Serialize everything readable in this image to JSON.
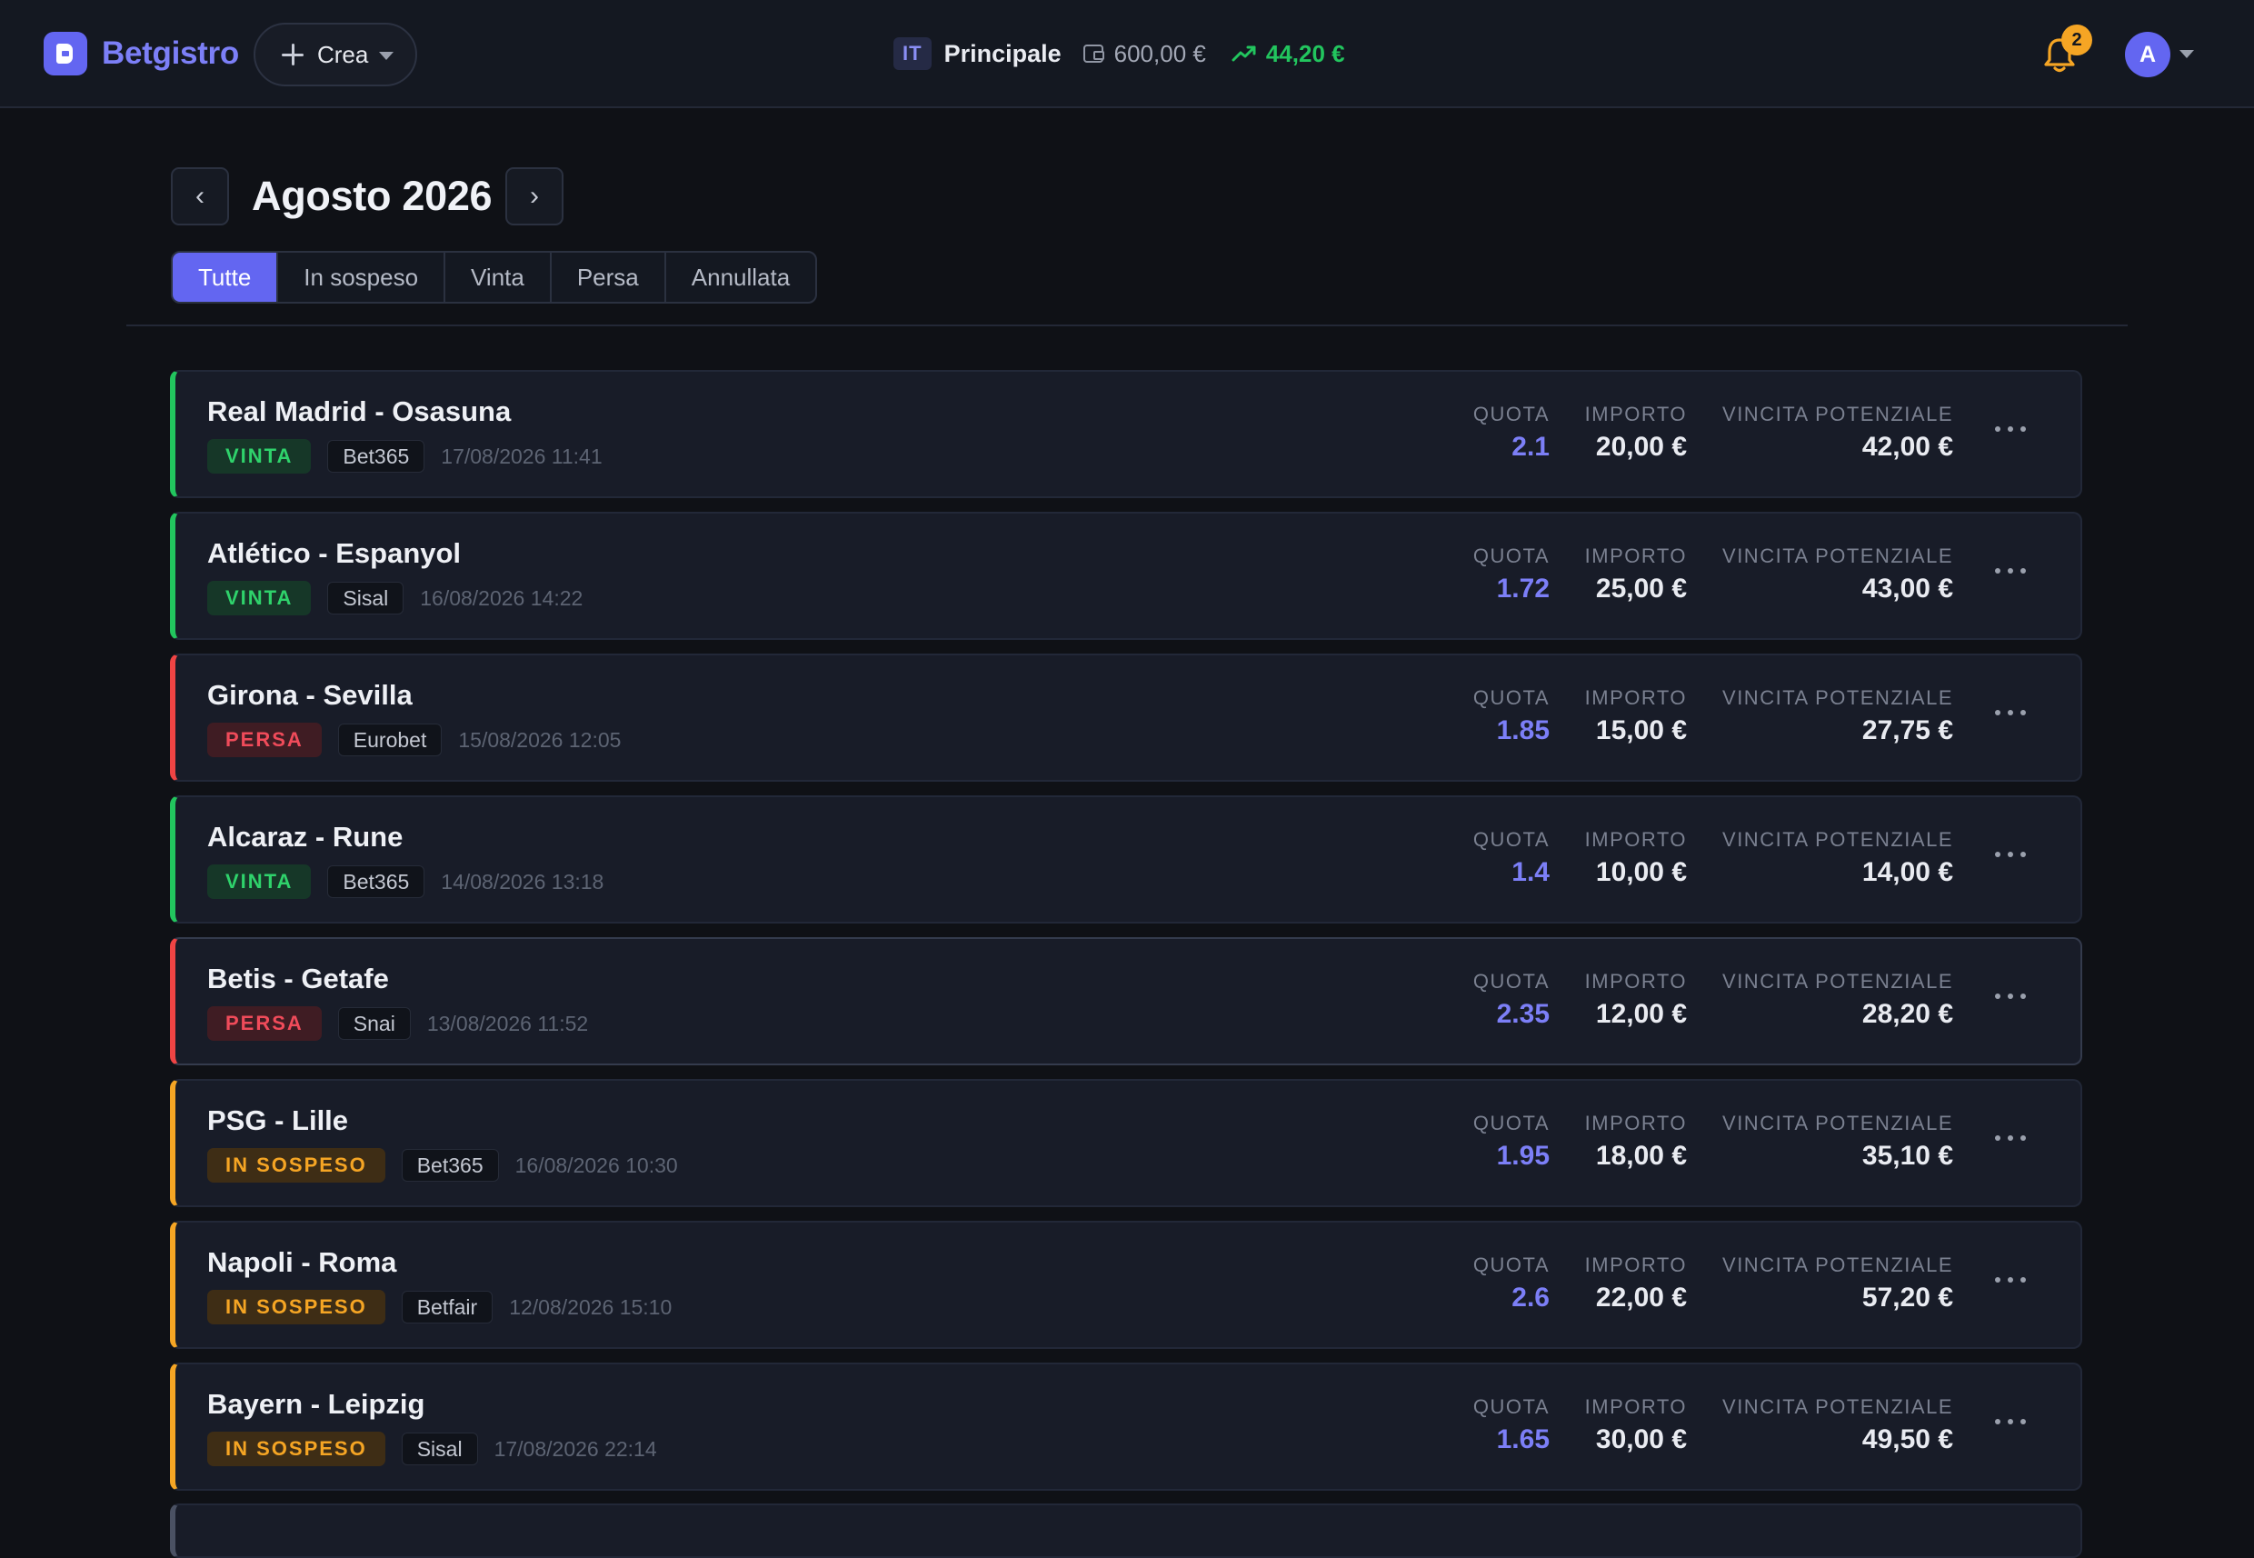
{
  "header": {
    "brand": "Betgistro",
    "create_label": "Crea",
    "account_code": "IT",
    "account_name": "Principale",
    "balance": "600,00 €",
    "profit": "44,20 €",
    "notifications_count": "2",
    "avatar_initial": "A",
    "colors": {
      "accent": "#6366f1",
      "profit": "#22c55e",
      "badge": "#f5a524"
    }
  },
  "month": {
    "prev_label": "‹",
    "title": "Agosto 2026",
    "next_label": "›"
  },
  "filters": [
    {
      "label": "Tutte",
      "active": true
    },
    {
      "label": "In sospeso",
      "active": false
    },
    {
      "label": "Vinta",
      "active": false
    },
    {
      "label": "Persa",
      "active": false
    },
    {
      "label": "Annullata",
      "active": false
    }
  ],
  "columns": {
    "quota": "QUOTA",
    "importo": "IMPORTO",
    "vincita": "VINCITA POTENZIALE"
  },
  "bets": [
    {
      "title": "Real Madrid - Osasuna",
      "status": "VINTA",
      "status_kind": "win",
      "book": "Bet365",
      "date": "17/08/2026 11:41",
      "quota": "2.1",
      "importo": "20,00 €",
      "vincita": "42,00 €"
    },
    {
      "title": "Atlético - Espanyol",
      "status": "VINTA",
      "status_kind": "win",
      "book": "Sisal",
      "date": "16/08/2026 14:22",
      "quota": "1.72",
      "importo": "25,00 €",
      "vincita": "43,00 €"
    },
    {
      "title": "Girona - Sevilla",
      "status": "PERSA",
      "status_kind": "loss",
      "book": "Eurobet",
      "date": "15/08/2026 12:05",
      "quota": "1.85",
      "importo": "15,00 €",
      "vincita": "27,75 €"
    },
    {
      "title": "Alcaraz - Rune",
      "status": "VINTA",
      "status_kind": "win",
      "book": "Bet365",
      "date": "14/08/2026 13:18",
      "quota": "1.4",
      "importo": "10,00 €",
      "vincita": "14,00 €"
    },
    {
      "title": "Betis - Getafe",
      "status": "PERSA",
      "status_kind": "loss",
      "book": "Snai",
      "date": "13/08/2026 11:52",
      "quota": "2.35",
      "importo": "12,00 €",
      "vincita": "28,20 €"
    },
    {
      "title": "PSG - Lille",
      "status": "IN SOSPESO",
      "status_kind": "pend",
      "book": "Bet365",
      "date": "16/08/2026 10:30",
      "quota": "1.95",
      "importo": "18,00 €",
      "vincita": "35,10 €"
    },
    {
      "title": "Napoli - Roma",
      "status": "IN SOSPESO",
      "status_kind": "pend",
      "book": "Betfair",
      "date": "12/08/2026 15:10",
      "quota": "2.6",
      "importo": "22,00 €",
      "vincita": "57,20 €"
    },
    {
      "title": "Bayern - Leipzig",
      "status": "IN SOSPESO",
      "status_kind": "pend",
      "book": "Sisal",
      "date": "17/08/2026 22:14",
      "quota": "1.65",
      "importo": "30,00 €",
      "vincita": "49,50 €"
    }
  ]
}
